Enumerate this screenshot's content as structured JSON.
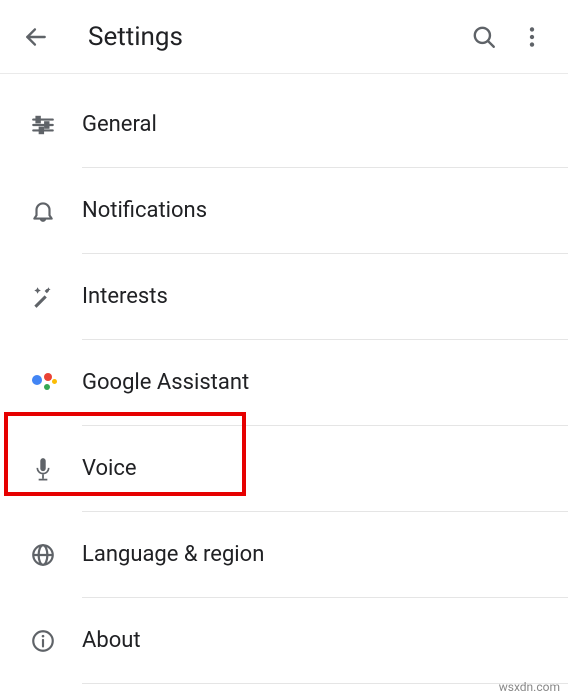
{
  "header": {
    "title": "Settings"
  },
  "items": [
    {
      "label": "General"
    },
    {
      "label": "Notifications"
    },
    {
      "label": "Interests"
    },
    {
      "label": "Google Assistant"
    },
    {
      "label": "Voice"
    },
    {
      "label": "Language & region"
    },
    {
      "label": "About"
    }
  ],
  "watermark": "wsxdn.com"
}
